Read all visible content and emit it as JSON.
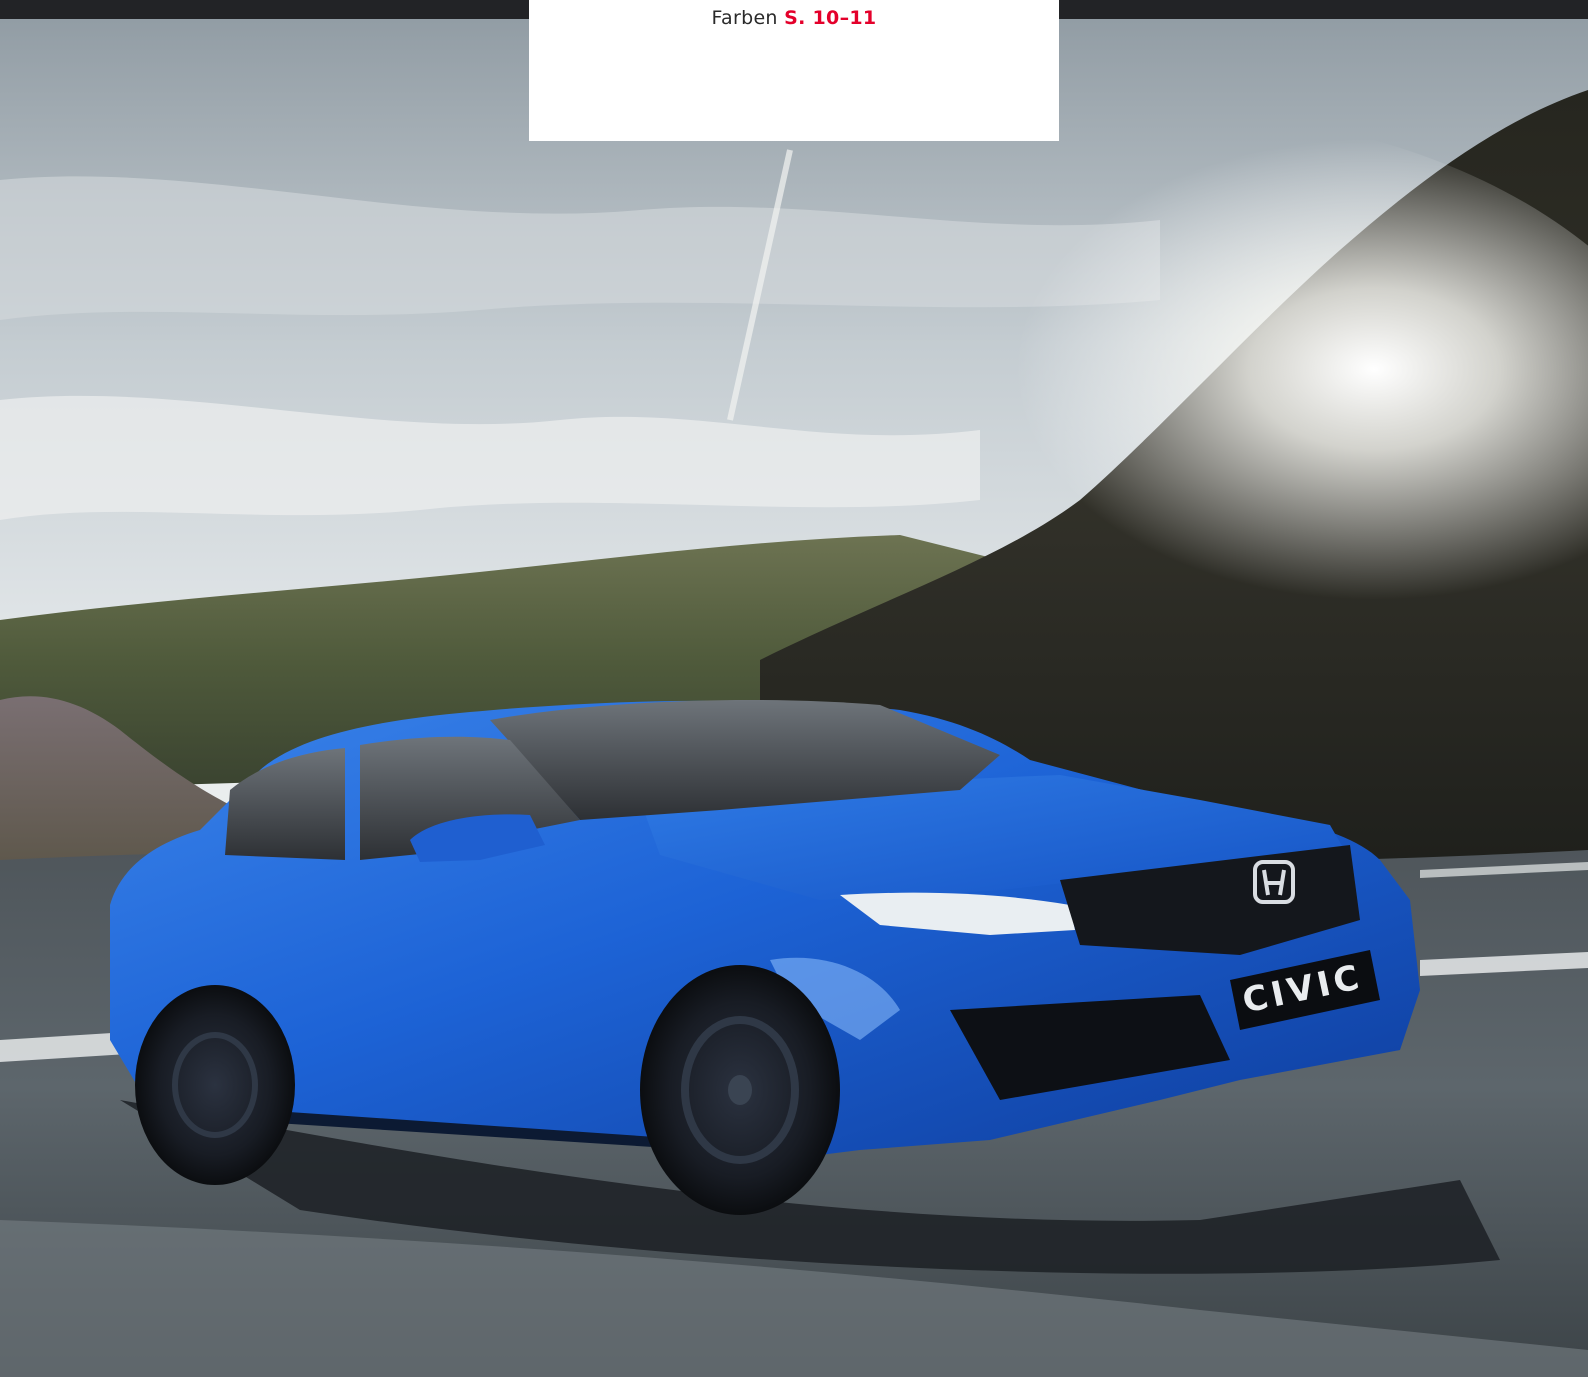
{
  "colors": {
    "accent": "#e4002b",
    "text": "#2a2a2a",
    "car_body": "#1d63d6",
    "topbar": "#222326"
  },
  "tab": {
    "label": "Farben",
    "page_ref": "S. 10–11"
  },
  "car": {
    "badge_text": "CIVIC",
    "logo_icon": "honda-h-logo-icon"
  }
}
